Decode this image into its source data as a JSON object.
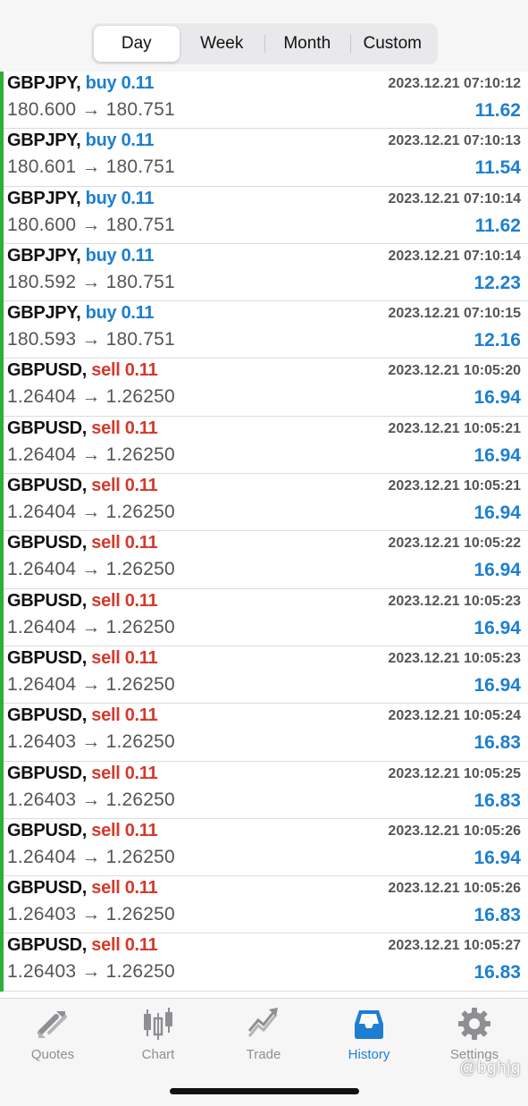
{
  "period_tabs": [
    {
      "label": "Day",
      "active": true
    },
    {
      "label": "Week",
      "active": false
    },
    {
      "label": "Month",
      "active": false
    },
    {
      "label": "Custom",
      "active": false
    }
  ],
  "arrow": "→",
  "deals": [
    {
      "symbol": "GBPJPY,",
      "side": "buy",
      "volume": "buy 0.11",
      "open": "180.600",
      "close": "180.751",
      "time": "2023.12.21 07:10:12",
      "profit": "11.62"
    },
    {
      "symbol": "GBPJPY,",
      "side": "buy",
      "volume": "buy 0.11",
      "open": "180.601",
      "close": "180.751",
      "time": "2023.12.21 07:10:13",
      "profit": "11.54"
    },
    {
      "symbol": "GBPJPY,",
      "side": "buy",
      "volume": "buy 0.11",
      "open": "180.600",
      "close": "180.751",
      "time": "2023.12.21 07:10:14",
      "profit": "11.62"
    },
    {
      "symbol": "GBPJPY,",
      "side": "buy",
      "volume": "buy 0.11",
      "open": "180.592",
      "close": "180.751",
      "time": "2023.12.21 07:10:14",
      "profit": "12.23"
    },
    {
      "symbol": "GBPJPY,",
      "side": "buy",
      "volume": "buy 0.11",
      "open": "180.593",
      "close": "180.751",
      "time": "2023.12.21 07:10:15",
      "profit": "12.16"
    },
    {
      "symbol": "GBPUSD,",
      "side": "sell",
      "volume": "sell 0.11",
      "open": "1.26404",
      "close": "1.26250",
      "time": "2023.12.21 10:05:20",
      "profit": "16.94"
    },
    {
      "symbol": "GBPUSD,",
      "side": "sell",
      "volume": "sell 0.11",
      "open": "1.26404",
      "close": "1.26250",
      "time": "2023.12.21 10:05:21",
      "profit": "16.94"
    },
    {
      "symbol": "GBPUSD,",
      "side": "sell",
      "volume": "sell 0.11",
      "open": "1.26404",
      "close": "1.26250",
      "time": "2023.12.21 10:05:21",
      "profit": "16.94"
    },
    {
      "symbol": "GBPUSD,",
      "side": "sell",
      "volume": "sell 0.11",
      "open": "1.26404",
      "close": "1.26250",
      "time": "2023.12.21 10:05:22",
      "profit": "16.94"
    },
    {
      "symbol": "GBPUSD,",
      "side": "sell",
      "volume": "sell 0.11",
      "open": "1.26404",
      "close": "1.26250",
      "time": "2023.12.21 10:05:23",
      "profit": "16.94"
    },
    {
      "symbol": "GBPUSD,",
      "side": "sell",
      "volume": "sell 0.11",
      "open": "1.26404",
      "close": "1.26250",
      "time": "2023.12.21 10:05:23",
      "profit": "16.94"
    },
    {
      "symbol": "GBPUSD,",
      "side": "sell",
      "volume": "sell 0.11",
      "open": "1.26403",
      "close": "1.26250",
      "time": "2023.12.21 10:05:24",
      "profit": "16.83"
    },
    {
      "symbol": "GBPUSD,",
      "side": "sell",
      "volume": "sell 0.11",
      "open": "1.26403",
      "close": "1.26250",
      "time": "2023.12.21 10:05:25",
      "profit": "16.83"
    },
    {
      "symbol": "GBPUSD,",
      "side": "sell",
      "volume": "sell 0.11",
      "open": "1.26404",
      "close": "1.26250",
      "time": "2023.12.21 10:05:26",
      "profit": "16.94"
    },
    {
      "symbol": "GBPUSD,",
      "side": "sell",
      "volume": "sell 0.11",
      "open": "1.26403",
      "close": "1.26250",
      "time": "2023.12.21 10:05:26",
      "profit": "16.83"
    },
    {
      "symbol": "GBPUSD,",
      "side": "sell",
      "volume": "sell 0.11",
      "open": "1.26403",
      "close": "1.26250",
      "time": "2023.12.21 10:05:27",
      "profit": "16.83"
    }
  ],
  "tabbar": [
    {
      "label": "Quotes",
      "icon": "quotes-icon",
      "active": false
    },
    {
      "label": "Chart",
      "icon": "chart-icon",
      "active": false
    },
    {
      "label": "Trade",
      "icon": "trade-icon",
      "active": false
    },
    {
      "label": "History",
      "icon": "history-icon",
      "active": true
    },
    {
      "label": "Settings",
      "icon": "gear-icon",
      "active": false
    }
  ],
  "watermark": "@bghjg",
  "colors": {
    "buy": "#1d7fd1",
    "sell": "#d33a2c",
    "profit": "#1d7fd1",
    "accent": "#1d7fd1",
    "deal_bar": "#2fae3a"
  }
}
